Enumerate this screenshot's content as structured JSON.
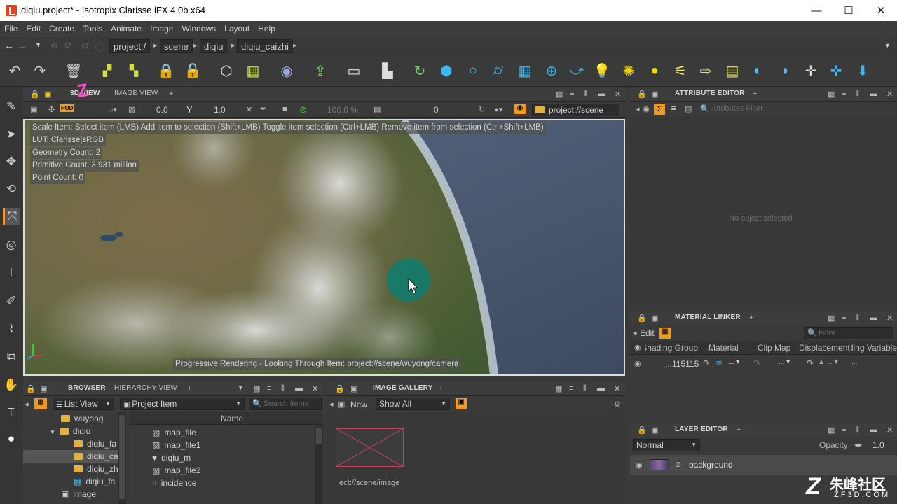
{
  "window": {
    "title": "diqiu.project* - Isotropix Clarisse iFX 4.0b x64",
    "minimize": "—",
    "maximize": "☐",
    "close": "✕"
  },
  "menus": [
    "File",
    "Edit",
    "Create",
    "Tools",
    "Animate",
    "Image",
    "Windows",
    "Layout",
    "Help"
  ],
  "path": {
    "crumbs": [
      "project:/",
      "scene",
      "diqiu",
      "diqiu_caizhi"
    ]
  },
  "viewport": {
    "tabs": {
      "active": "3D VIEW",
      "other": "IMAGE VIEW"
    },
    "controls": {
      "hud": "HUD",
      "angle": "0.0",
      "gamma_label": "Y",
      "gamma": "1.0",
      "zoom": "100.0 %",
      "frame": "0",
      "scene_path": "project://scene"
    },
    "info": {
      "hint": "Scale Item: Select item (LMB)  Add item to selection (Shift+LMB)  Toggle item selection (Ctrl+LMB)  Remove item from selection (Ctrl+Shift+LMB)",
      "lut": "LUT: Clarisse|sRGB",
      "geometry": "Geometry Count: 2",
      "primitives": "Primitive Count: 3.931 million",
      "points": "Point Count: 0"
    },
    "status": "Progressive Rendering - Looking Through Item: project://scene/wuyong/camera"
  },
  "attribute_editor": {
    "title": "ATTRIBUTE EDITOR",
    "filter_placeholder": "Attributes Filter",
    "empty": "No object selected"
  },
  "material_linker": {
    "title": "MATERIAL LINKER",
    "edit": "Edit",
    "filter_placeholder": "Filter",
    "columns": [
      "Shading Group",
      "Material",
      "Clip Map",
      "Displacement",
      "Shading Variable"
    ],
    "row": {
      "name": "...115115"
    }
  },
  "layer_editor": {
    "title": "LAYER EDITOR",
    "blend": "Normal",
    "opacity_label": "Opacity",
    "opacity": "1.0",
    "layer": "background"
  },
  "browser": {
    "tabs": {
      "active": "BROWSER",
      "other": "HIERARCHY VIEW"
    },
    "view_mode": "List View",
    "item_type": "Project Item",
    "search_placeholder": "Search items",
    "tree": [
      {
        "label": "wuyong",
        "depth": 1,
        "icon": "folder"
      },
      {
        "label": "diqiu",
        "depth": 1,
        "icon": "folder",
        "expanded": true
      },
      {
        "label": "diqiu_fa",
        "depth": 2,
        "icon": "folder"
      },
      {
        "label": "diqiu_ca",
        "depth": 2,
        "icon": "folder",
        "selected": true
      },
      {
        "label": "diqiu_zh",
        "depth": 2,
        "icon": "folder"
      },
      {
        "label": "diqiu_fa",
        "depth": 2,
        "icon": "grid"
      },
      {
        "label": "image",
        "depth": 1,
        "icon": "image"
      }
    ],
    "list_header": "Name",
    "items": [
      "map_file",
      "map_file1",
      "diqiu_m",
      "map_file2",
      "incidence"
    ]
  },
  "image_gallery": {
    "title": "IMAGE GALLERY",
    "new": "New",
    "show": "Show All",
    "thumb_label": "...ect://scene/image"
  },
  "watermark": {
    "text": "朱峰社区",
    "sub": "ZF3D.COM"
  },
  "colors": {
    "accent_yellow": "#e9c32b",
    "accent_blue": "#3fb7f0",
    "cursor_teal": "#0f7d6e",
    "selected_orange": "#f09a20"
  }
}
